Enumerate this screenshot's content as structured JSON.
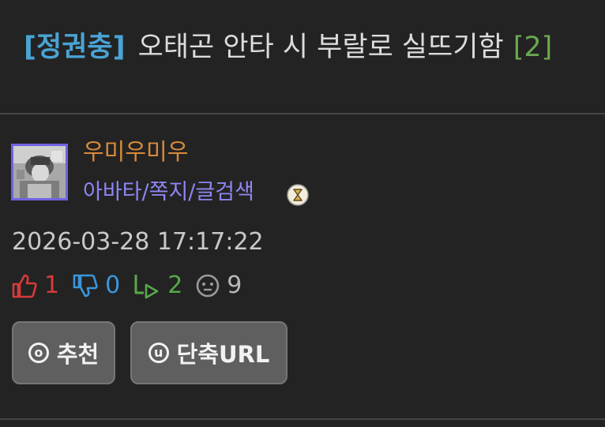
{
  "post": {
    "tag": "[정권충]",
    "title": "오태곤 안타 시 부랄로 실뜨기함",
    "comment_count": "[2]"
  },
  "author": {
    "nickname": "우미우미우",
    "links": "아바타/쪽지/글검색",
    "avatar_icon": "avatar-image",
    "badge_icon": "hourglass-badge-icon"
  },
  "meta": {
    "datetime": "2026-03-28 17:17:22"
  },
  "stats": {
    "upvotes": "1",
    "downvotes": "0",
    "replies": "2",
    "views": "9"
  },
  "buttons": {
    "recommend_icon": "ⓞ",
    "recommend_label": "추천",
    "shorturl_icon": "u",
    "shorturl_label": "단축URL"
  },
  "colors": {
    "background": "#232323",
    "tag": "#4aa3d4",
    "comment_count": "#6aa84f",
    "nickname": "#d98a3a",
    "links": "#8c86f2",
    "upvote": "#d63a3a",
    "downvote": "#3a96dc",
    "reply": "#57a84a",
    "view": "#b9b9b9",
    "button_bg": "#5f5f5f"
  }
}
